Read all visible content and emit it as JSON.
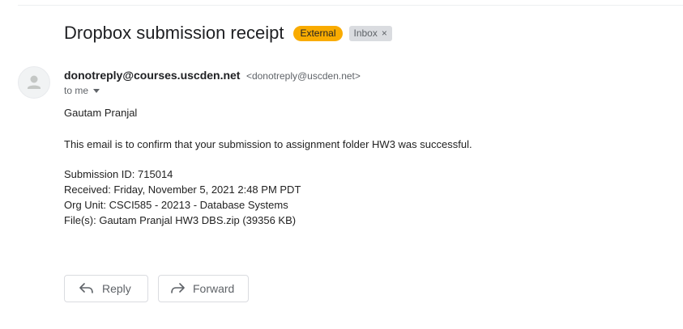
{
  "email": {
    "subject": "Dropbox submission receipt",
    "labels": {
      "external": "External",
      "inbox": "Inbox",
      "inbox_remove": "×"
    },
    "sender": {
      "name": "donotreply@courses.uscden.net",
      "email": "<donotreply@uscden.net>"
    },
    "recipient": "to me",
    "body": {
      "greeting": "Gautam Pranjal",
      "confirmation": "This email is to confirm that your submission to assignment folder HW3 was successful.",
      "submission_id": "Submission ID: 715014",
      "received": "Received: Friday, November 5, 2021 2:48 PM PDT",
      "org_unit": "Org Unit: CSCI585 - 20213 - Database Systems",
      "files": "File(s): Gautam Pranjal HW3 DBS.zip (39356 KB)"
    }
  },
  "actions": {
    "reply": "Reply",
    "forward": "Forward"
  },
  "icons": {
    "avatar": "person-icon",
    "reply": "reply-arrow-icon",
    "forward": "forward-arrow-icon",
    "caret": "chevron-down-icon"
  },
  "colors": {
    "external_label": "#f9ab00",
    "inbox_label": "#dadce0",
    "secondary_text": "#5f6368"
  }
}
